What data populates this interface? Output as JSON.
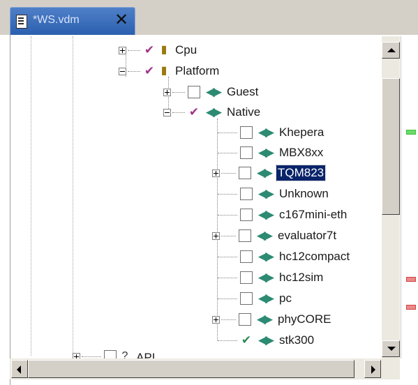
{
  "tab": {
    "title": "*WS.vdm",
    "close_glyph": "✕"
  },
  "tree": {
    "nodes": [
      {
        "label": "Cpu",
        "state": "checked",
        "icon": "lightbulb-icon"
      },
      {
        "label": "Platform",
        "state": "checked",
        "icon": "lightbulb-icon"
      },
      {
        "label": "Guest",
        "state": "unchecked",
        "icon": "connector-icon"
      },
      {
        "label": "Native",
        "state": "checked",
        "icon": "connector-icon"
      },
      {
        "label": "Khepera",
        "state": "unchecked",
        "icon": "connector-icon"
      },
      {
        "label": "MBX8xx",
        "state": "unchecked",
        "icon": "connector-icon"
      },
      {
        "label": "TQM823",
        "state": "unchecked",
        "icon": "connector-icon",
        "selected": true
      },
      {
        "label": "Unknown",
        "state": "unchecked",
        "icon": "connector-icon"
      },
      {
        "label": "c167mini-eth",
        "state": "unchecked",
        "icon": "connector-icon"
      },
      {
        "label": "evaluator7t",
        "state": "unchecked",
        "icon": "connector-icon"
      },
      {
        "label": "hc12compact",
        "state": "unchecked",
        "icon": "connector-icon"
      },
      {
        "label": "hc12sim",
        "state": "unchecked",
        "icon": "connector-icon"
      },
      {
        "label": "pc",
        "state": "unchecked",
        "icon": "connector-icon"
      },
      {
        "label": "phyCORE",
        "state": "unchecked",
        "icon": "connector-icon"
      },
      {
        "label": "stk300",
        "state": "checked",
        "icon": "connector-icon"
      },
      {
        "label": "API",
        "state": "unchecked",
        "icon": "question-icon"
      }
    ]
  },
  "overview_markers": [
    {
      "color": "#44bb44"
    },
    {
      "color": "#cc4444"
    },
    {
      "color": "#cc4444"
    }
  ],
  "colors": {
    "selection": "#0a246a",
    "tab_active": "#3a6bbd",
    "check_mark": "#a0338a"
  }
}
